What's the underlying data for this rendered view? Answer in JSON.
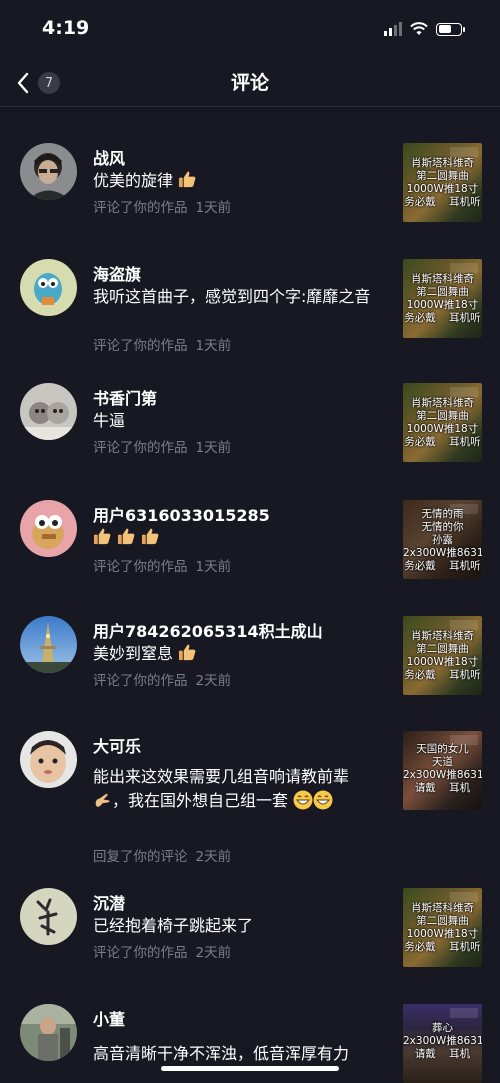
{
  "status_bar": {
    "time": "4:19"
  },
  "nav": {
    "back_count": "7",
    "title": "评论"
  },
  "comments": [
    {
      "name": "战风",
      "text": "优美的旋律",
      "action": "评论了你的作品",
      "time": "1天前",
      "thumb": "肖斯塔科维奇\n第二圆舞曲\n1000W推18寸\n务必戴    耳机听"
    },
    {
      "name": "海盗旗",
      "text": "我听这首曲子，感觉到四个字:靡靡之音",
      "action": "评论了你的作品",
      "time": "1天前",
      "thumb": "肖斯塔科维奇\n第二圆舞曲\n1000W推18寸\n务必戴    耳机听"
    },
    {
      "name": "书香门第",
      "text": "牛逼",
      "action": "评论了你的作品",
      "time": "1天前",
      "thumb": "肖斯塔科维奇\n第二圆舞曲\n1000W推18寸\n务必戴    耳机听"
    },
    {
      "name": "用户6316033015285",
      "text": "",
      "action": "评论了你的作品",
      "time": "1天前",
      "thumb": "无情的雨\n无情的你\n孙露\n2x300W推8631\n务必戴    耳机听"
    },
    {
      "name": "用户784262065314积土成山",
      "text": "美妙到窒息",
      "action": "评论了你的作品",
      "time": "2天前",
      "thumb": "肖斯塔科维奇\n第二圆舞曲\n1000W推18寸\n务必戴    耳机听"
    },
    {
      "name": "大可乐",
      "text": "能出来这效果需要几组音响请教前辈",
      "text2": "，我在国外想自己组一套",
      "action": "回复了你的评论",
      "time": "2天前",
      "thumb": "天国的女儿\n天道\n2x300W推8631\n请戴    耳机"
    },
    {
      "name": "沉潜",
      "text": "已经抱着椅子跳起来了",
      "action": "评论了你的作品",
      "time": "2天前",
      "thumb": "肖斯塔科维奇\n第二圆舞曲\n1000W推18寸\n务必戴    耳机听"
    },
    {
      "name": "小董",
      "text": "高音清晰干净不浑浊，低音浑厚有力",
      "action": "",
      "time": "",
      "thumb": "葬心\n2x300W推8631\n请戴    耳机"
    }
  ]
}
